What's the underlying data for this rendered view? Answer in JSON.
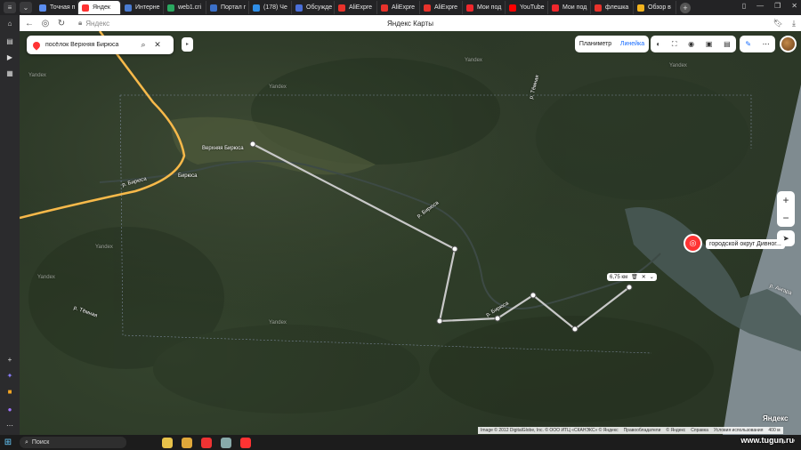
{
  "browser": {
    "tabs": [
      {
        "label": "Точная п",
        "color": "#5b8def"
      },
      {
        "label": "Яндек",
        "color": "#ff3333",
        "active": true
      },
      {
        "label": "Интерне",
        "color": "#4a7bd0"
      },
      {
        "label": "web1.cri",
        "color": "#2aa860"
      },
      {
        "label": "Портал г",
        "color": "#3b70c8"
      },
      {
        "label": "(178) Че",
        "color": "#2f8fe8"
      },
      {
        "label": "Обсужде",
        "color": "#4a6fd8"
      },
      {
        "label": "AliExpre",
        "color": "#e8322b"
      },
      {
        "label": "AliExpre",
        "color": "#e8322b"
      },
      {
        "label": "AliExpre",
        "color": "#e8322b"
      },
      {
        "label": "Мои под",
        "color": "#f0272c"
      },
      {
        "label": "YouTube",
        "color": "#ff0000"
      },
      {
        "label": "Мои под",
        "color": "#f0272c"
      },
      {
        "label": "флешка",
        "color": "#e8322b"
      },
      {
        "label": "Обзор в",
        "color": "#f2b31d"
      }
    ],
    "address": {
      "url_text": "Яндекс",
      "page_title": "Яндекс Карты"
    }
  },
  "search": {
    "value": "посёлок Верхняя Бирюса"
  },
  "toolbar": {
    "planimeter": "Планиметр",
    "ruler": "Линейка"
  },
  "map": {
    "labels": {
      "village": "Верхняя Бирюса",
      "village_stop": "Бирюса",
      "river1": "р. Бирюса",
      "river2": "р. Бирюса",
      "river3": "р. Бирюса",
      "river4": "р. Тёмная",
      "river5": "р. Ангара",
      "yandex_wm": "Yandex"
    },
    "distance": "6,75 км",
    "place_label": "городской округ Дивног...",
    "logo": "Яндекс",
    "attribution": [
      "Image © 2012 DigitalGlobe, Inc. © ООО ИТЦ «СКАНЭКС» © Яндекс",
      "Правообладатели",
      "© Яндекс",
      "Справка",
      "Условия использования"
    ],
    "scale": "400 м"
  },
  "taskbar": {
    "search_placeholder": "Поиск",
    "watermark": "www.tugun.ru"
  }
}
